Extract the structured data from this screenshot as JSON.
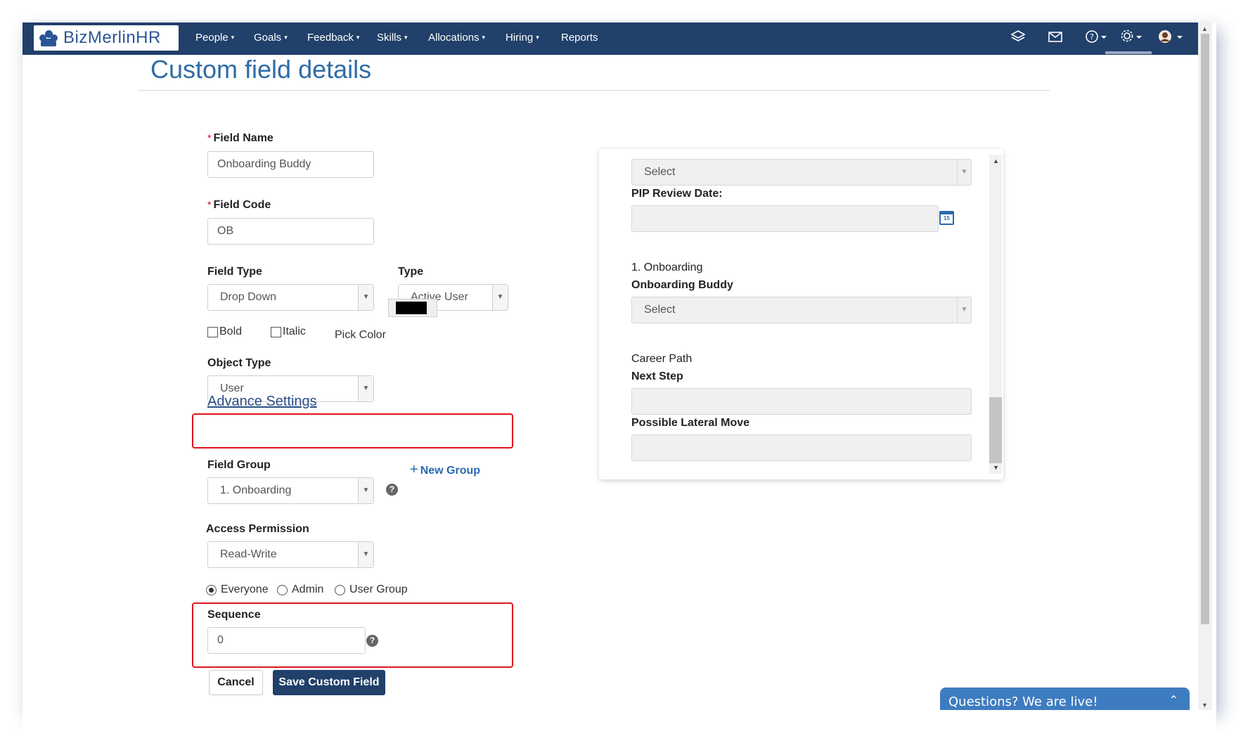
{
  "brand": {
    "name": "BizMerlinHR"
  },
  "nav": {
    "items": [
      "People",
      "Goals",
      "Feedback",
      "Skills",
      "Allocations",
      "Hiring",
      "Reports"
    ],
    "caret": "▾",
    "icons": [
      "layers-icon",
      "mail-icon",
      "help-icon",
      "gear-icon",
      "avatar"
    ]
  },
  "page": {
    "title": "Custom field details"
  },
  "form": {
    "field_name": {
      "label": "Field Name",
      "value": "Onboarding Buddy"
    },
    "field_code": {
      "label": "Field Code",
      "value": "OB"
    },
    "field_type": {
      "label": "Field Type",
      "value": "Drop Down"
    },
    "type": {
      "label": "Type",
      "value": "Active User"
    },
    "bold_label": "Bold",
    "italic_label": "Italic",
    "pick_color_label": "Pick Color",
    "pick_color_value": "#000000",
    "object_type": {
      "label": "Object Type",
      "value": "User"
    },
    "advance_settings": "Advance Settings",
    "field_group": {
      "label": "Field Group",
      "value": "1. Onboarding",
      "new_group": "New Group"
    },
    "access_permission": {
      "label": "Access Permission",
      "value": "Read-Write"
    },
    "radios": [
      "Everyone",
      "Admin",
      "User Group"
    ],
    "radio_selected": "Everyone",
    "sequence": {
      "label": "Sequence",
      "value": "0"
    },
    "cancel": "Cancel",
    "save": "Save Custom Field"
  },
  "preview": {
    "top_select": "Select",
    "pip_label": "PIP Review Date:",
    "section1": "1. Onboarding",
    "buddy_label": "Onboarding Buddy",
    "buddy_select": "Select",
    "career_path": "Career Path",
    "next_step": "Next Step",
    "lateral": "Possible Lateral Move"
  },
  "chat": {
    "text": "Questions? We are live!"
  },
  "colors": {
    "navbar": "#21406a",
    "title": "#2e6ca6",
    "highlight": "#e0141f",
    "primary_button": "#21406a",
    "chat": "#3e7cc0"
  }
}
